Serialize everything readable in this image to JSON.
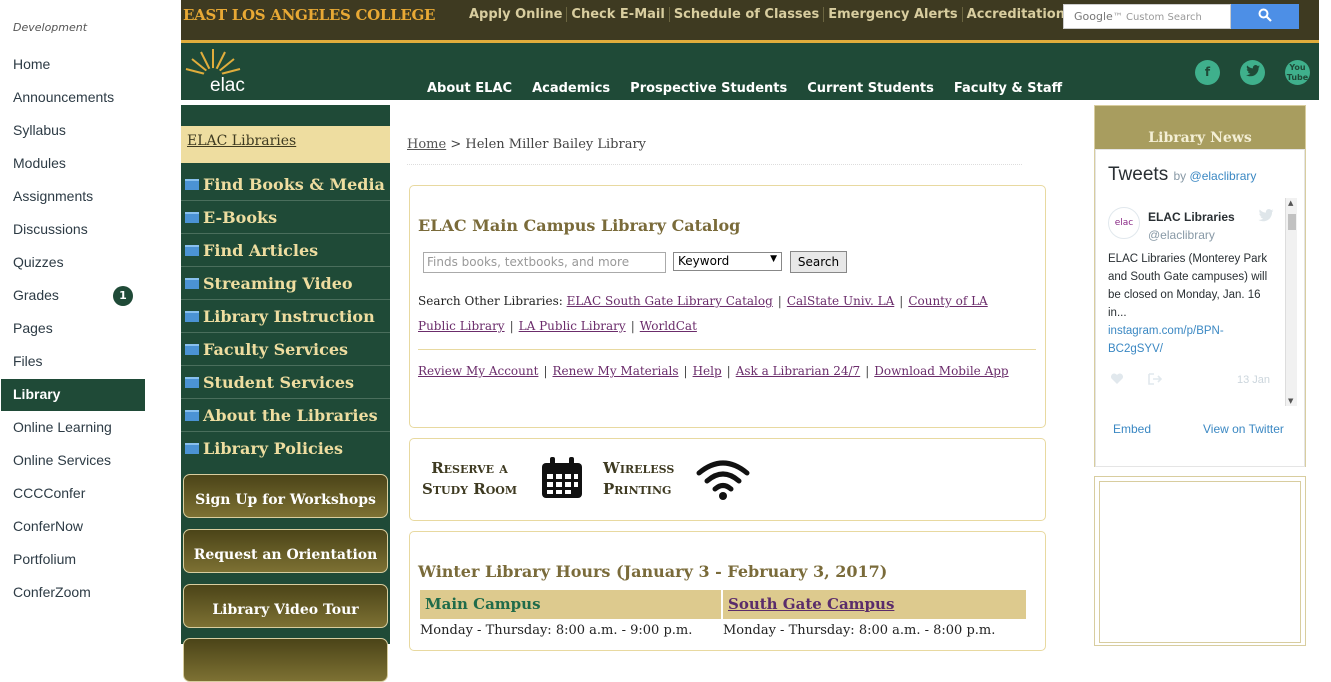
{
  "canvas_nav": {
    "heading": "Development",
    "items": [
      "Home",
      "Announcements",
      "Syllabus",
      "Modules",
      "Assignments",
      "Discussions",
      "Quizzes",
      "Grades",
      "Pages",
      "Files",
      "Library",
      "Online Learning",
      "Online Services",
      "CCCConfer",
      "ConferNow",
      "Portfolium",
      "ConferZoom"
    ],
    "active": "Library",
    "grades_badge": "1"
  },
  "topbar": {
    "college_name": "EAST LOS ANGELES COLLEGE",
    "links": [
      "Apply Online",
      "Check E-Mail",
      "Schedule of Classes",
      "Emergency Alerts",
      "Accreditation"
    ],
    "search_placeholder": "Custom Search",
    "search_brand": "Google"
  },
  "header": {
    "logo_text": "elac",
    "nav": [
      "About ELAC",
      "Academics",
      "Prospective Students",
      "Current Students",
      "Faculty & Staff"
    ],
    "social": [
      "facebook-icon",
      "twitter-icon",
      "youtube-icon"
    ]
  },
  "sidebar": {
    "title": "ELAC Libraries",
    "menu": [
      "Find Books & Media",
      "E-Books",
      "Find Articles",
      "Streaming Video",
      "Library Instruction",
      "Faculty Services",
      "Student Services",
      "About the Libraries",
      "Library Policies"
    ],
    "buttons": [
      "Sign Up for Workshops",
      "Request an Orientation",
      "Library Video Tour"
    ]
  },
  "breadcrumb": {
    "home": "Home",
    "sep": ">",
    "current": "Helen Miller Bailey Library"
  },
  "catalog": {
    "title": "ELAC Main Campus Library Catalog",
    "input_placeholder": "Finds books, textbooks, and more",
    "select_value": "Keyword",
    "button": "Search",
    "other_label": "Search Other Libraries:",
    "other_links": [
      "ELAC South Gate Library Catalog",
      "CalState Univ. LA",
      "County of LA Public Library",
      "LA Public Library",
      "WorldCat"
    ],
    "account_links": [
      "Review My Account",
      "Renew My Materials",
      "Help",
      "Ask a Librarian 24/7",
      "Download Mobile App"
    ]
  },
  "banner": {
    "reserve_line1": "Reserve a",
    "reserve_line2": "Study Room",
    "wireless_line1": "Wireless",
    "wireless_line2": "Printing"
  },
  "hours": {
    "title": "Winter Library Hours (January 3 - February 3, 2017)",
    "main_campus": "Main Campus",
    "south_gate": "South Gate Campus",
    "main_row": "Monday - Thursday: 8:00 a.m. - 9:00 p.m.",
    "south_row": "Monday - Thursday: 8:00 a.m. - 8:00 p.m."
  },
  "news": {
    "title": "Library News",
    "tweets_label": "Tweets",
    "by": "by",
    "handle_link": "@elaclibrary",
    "author_name": "ELAC Libraries",
    "author_handle": "@elaclibrary",
    "avatar_text": "elac",
    "tweet_text": "ELAC Libraries (Monterey Park and South Gate campuses) will be closed on Monday, Jan. 16 in...",
    "tweet_link": "instagram.com/p/BPN-BC2gSYV/",
    "tweet_date": "13 Jan",
    "embed": "Embed",
    "view_on": "View on Twitter"
  },
  "colors": {
    "green": "#1f4a37",
    "olive": "#3e3a21",
    "gold": "#e0ad3c",
    "tan": "#eedda0"
  }
}
